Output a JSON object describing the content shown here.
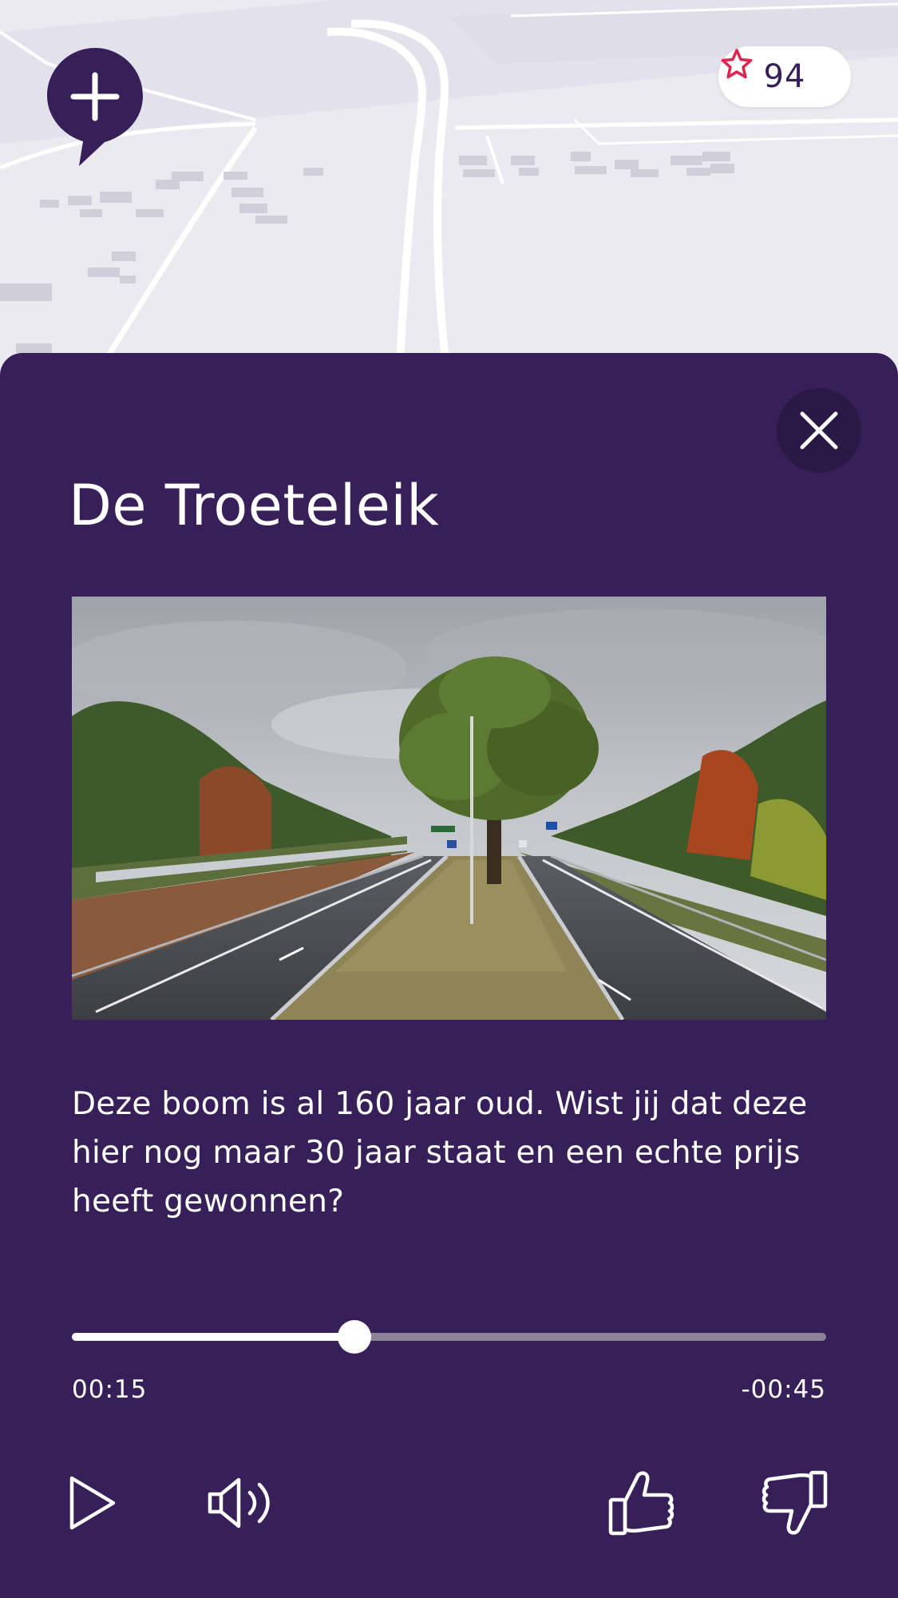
{
  "map": {
    "points_count": "94",
    "add_button_icon": "plus-pin-icon",
    "points_icon": "star-icon"
  },
  "sheet": {
    "title": "De Troeteleik",
    "photo_icon": "highway-tree-photo",
    "description": "Deze boom is al 160 jaar oud. Wist jij dat deze hier nog maar 30 jaar staat en een echte prijs heeft gewonnen?",
    "close_icon": "close-icon"
  },
  "player": {
    "elapsed": "00:15",
    "remaining": "-00:45",
    "progress": 0.375,
    "play_icon": "play-icon",
    "volume_icon": "volume-icon",
    "like_icon": "thumbs-up-icon",
    "dislike_icon": "thumbs-down-icon"
  },
  "colors": {
    "sheet_background": "#37205a",
    "accent_star": "#e0234e",
    "map_background": "#ebeaf1"
  }
}
